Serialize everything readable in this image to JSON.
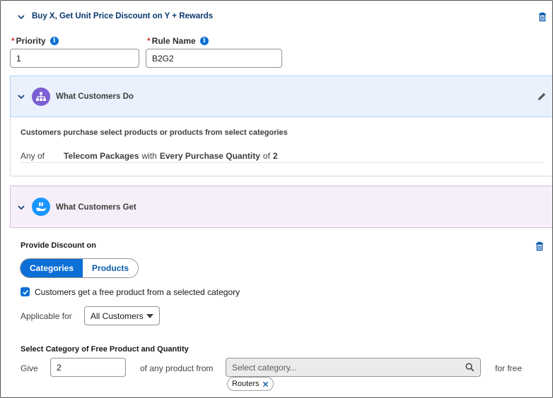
{
  "top": {
    "rule_title": "Buy X, Get Unit Price Discount on Y + Rewards"
  },
  "fields": {
    "required_marker": "*",
    "priority_label": "Priority",
    "priority_value": "1",
    "rule_name_label": "Rule Name",
    "rule_name_value": "B2G2",
    "info_glyph": "i"
  },
  "what_customers_do": {
    "title": "What Customers Do",
    "description": "Customers purchase select products or products from select categories",
    "any_of": "Any of",
    "item": "Telecom Packages",
    "with": "with",
    "condition": "Every Purchase Quantity",
    "of": "of",
    "quantity": "2"
  },
  "what_customers_get": {
    "title": "What Customers Get",
    "provide_label": "Provide Discount on",
    "tabs": [
      "Categories",
      "Products"
    ],
    "active_tab": "Categories",
    "checkbox_label": "Customers get a free product from a selected category",
    "checkbox_checked": true,
    "applicable_label": "Applicable for",
    "applicable_value": "All Customers",
    "select_heading": "Select Category of Free Product and Quantity",
    "give_label": "Give",
    "give_value": "2",
    "any_product_label": "of any product from",
    "category_placeholder": "Select category...",
    "for_free_label": "for free",
    "selected_pill": "Routers"
  },
  "colors": {
    "brand_blue": "#0b6fd6",
    "icon_purple": "#7b5fd3",
    "icon_blue": "#1b96ff"
  },
  "icons": [
    "chevron-down-icon",
    "trash-icon",
    "info-icon",
    "hierarchy-icon",
    "pencil-icon",
    "gift-hand-icon",
    "checkmark-icon",
    "caret-down-icon",
    "search-icon",
    "close-icon"
  ]
}
